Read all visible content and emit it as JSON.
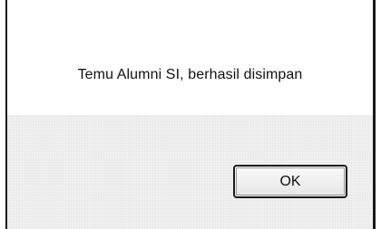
{
  "dialog": {
    "message": "Temu Alumni SI, berhasil disimpan",
    "ok_label": "OK"
  }
}
